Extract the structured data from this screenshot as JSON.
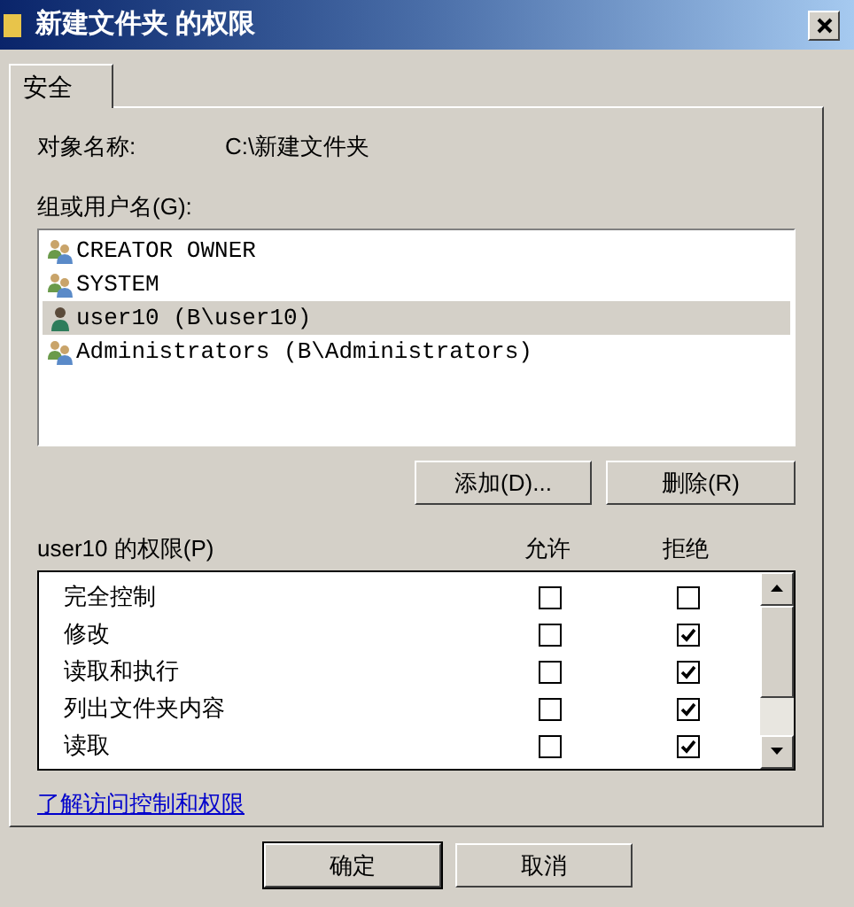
{
  "window": {
    "title": "新建文件夹 的权限"
  },
  "tabs": [
    {
      "label": "安全",
      "selected": true
    }
  ],
  "object_name": {
    "label": "对象名称:",
    "value": "C:\\新建文件夹"
  },
  "users": {
    "label": "组或用户名(G):",
    "items": [
      {
        "name": "CREATOR OWNER",
        "kind": "group",
        "selected": false
      },
      {
        "name": "SYSTEM",
        "kind": "group",
        "selected": false
      },
      {
        "name": "user10 (B\\user10)",
        "kind": "user",
        "selected": true
      },
      {
        "name": "Administrators (B\\Administrators)",
        "kind": "group",
        "selected": false
      }
    ],
    "buttons": [
      "添加(D)...",
      "删除(R)"
    ]
  },
  "permissions": {
    "label": "user10 的权限(P)",
    "allow_header": "允许",
    "deny_header": "拒绝",
    "rows": [
      {
        "name": "完全控制",
        "allow": false,
        "deny": false
      },
      {
        "name": "修改",
        "allow": false,
        "deny": true
      },
      {
        "name": "读取和执行",
        "allow": false,
        "deny": true
      },
      {
        "name": "列出文件夹内容",
        "allow": false,
        "deny": true
      },
      {
        "name": "读取",
        "allow": false,
        "deny": true
      }
    ]
  },
  "link": "了解访问控制和权限",
  "buttons": [
    "确定",
    "取消"
  ]
}
